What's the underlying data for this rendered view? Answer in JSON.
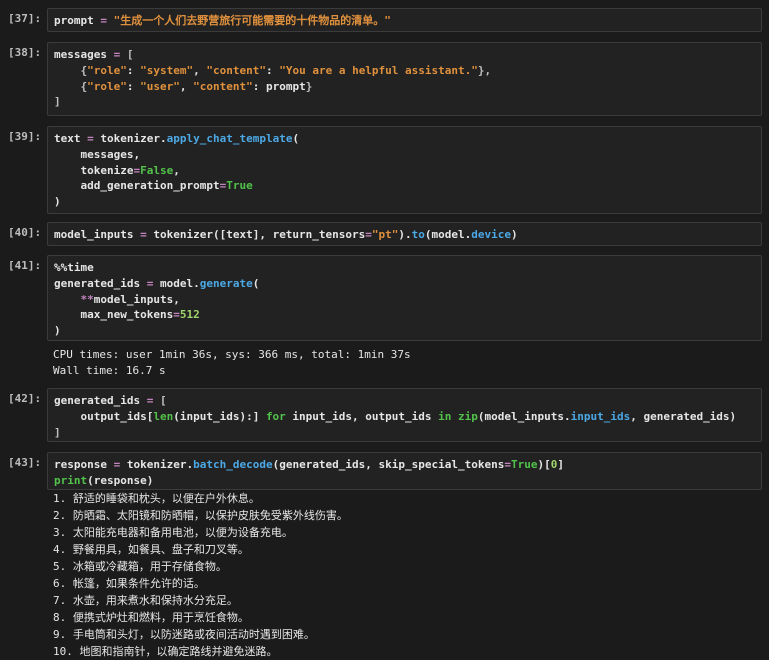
{
  "cells": [
    {
      "id": "cell-37",
      "label": "[37]:",
      "lines": [
        [
          [
            "var",
            "prompt"
          ],
          [
            "op",
            " = "
          ],
          [
            "str",
            "\"生成一个人们去野营旅行可能需要的十件物品的清单。\""
          ]
        ]
      ]
    },
    {
      "id": "cell-38",
      "label": "[38]:",
      "lines": [
        [
          [
            "var",
            "messages"
          ],
          [
            "op",
            " = "
          ],
          [
            "br",
            "["
          ]
        ],
        [
          [
            "var",
            "    "
          ],
          [
            "br",
            "{"
          ],
          [
            "str",
            "\"role\""
          ],
          [
            "var",
            ": "
          ],
          [
            "str",
            "\"system\""
          ],
          [
            "var",
            ", "
          ],
          [
            "str",
            "\"content\""
          ],
          [
            "var",
            ": "
          ],
          [
            "str",
            "\"You are a helpful assistant.\""
          ],
          [
            "br",
            "},"
          ]
        ],
        [
          [
            "var",
            "    "
          ],
          [
            "br",
            "{"
          ],
          [
            "str",
            "\"role\""
          ],
          [
            "var",
            ": "
          ],
          [
            "str",
            "\"user\""
          ],
          [
            "var",
            ", "
          ],
          [
            "str",
            "\"content\""
          ],
          [
            "var",
            ": prompt"
          ],
          [
            "br",
            "}"
          ]
        ],
        [
          [
            "br",
            "]"
          ]
        ]
      ]
    },
    {
      "id": "cell-39",
      "label": "[39]:",
      "lines": [
        [
          [
            "var",
            "text"
          ],
          [
            "op",
            " = "
          ],
          [
            "var",
            "tokenizer."
          ],
          [
            "fn",
            "apply_chat_template"
          ],
          [
            "var",
            "("
          ]
        ],
        [
          [
            "var",
            "    messages,"
          ]
        ],
        [
          [
            "var",
            "    tokenize"
          ],
          [
            "op",
            "="
          ],
          [
            "kw",
            "False"
          ],
          [
            "var",
            ","
          ]
        ],
        [
          [
            "var",
            "    add_generation_prompt"
          ],
          [
            "op",
            "="
          ],
          [
            "kw",
            "True"
          ]
        ],
        [
          [
            "var",
            ")"
          ]
        ]
      ]
    },
    {
      "id": "cell-40",
      "label": "[40]:",
      "lines": [
        [
          [
            "var",
            "model_inputs"
          ],
          [
            "op",
            " = "
          ],
          [
            "var",
            "tokenizer([text], return_tensors"
          ],
          [
            "op",
            "="
          ],
          [
            "str",
            "\"pt\""
          ],
          [
            "var",
            ")."
          ],
          [
            "fn",
            "to"
          ],
          [
            "var",
            "(model."
          ],
          [
            "fn",
            "device"
          ],
          [
            "var",
            ")"
          ]
        ]
      ]
    },
    {
      "id": "cell-41",
      "label": "[41]:",
      "lines": [
        [
          [
            "var",
            "%%time"
          ]
        ],
        [
          [
            "var",
            "generated_ids"
          ],
          [
            "op",
            " = "
          ],
          [
            "var",
            "model."
          ],
          [
            "fn",
            "generate"
          ],
          [
            "var",
            "("
          ]
        ],
        [
          [
            "var",
            "    "
          ],
          [
            "op",
            "**"
          ],
          [
            "var",
            "model_inputs,"
          ]
        ],
        [
          [
            "var",
            "    max_new_tokens"
          ],
          [
            "op",
            "="
          ],
          [
            "num",
            "512"
          ]
        ],
        [
          [
            "var",
            ")"
          ]
        ]
      ]
    },
    {
      "id": "cell-42",
      "label": "[42]:",
      "lines": [
        [
          [
            "var",
            "generated_ids"
          ],
          [
            "op",
            " = "
          ],
          [
            "br",
            "["
          ]
        ],
        [
          [
            "var",
            "    output_ids["
          ],
          [
            "kw",
            "len"
          ],
          [
            "var",
            "(input_ids):] "
          ],
          [
            "kw",
            "for"
          ],
          [
            "var",
            " input_ids, output_ids "
          ],
          [
            "kw",
            "in"
          ],
          [
            "var",
            " "
          ],
          [
            "kw",
            "zip"
          ],
          [
            "var",
            "(model_inputs."
          ],
          [
            "fn",
            "input_ids"
          ],
          [
            "var",
            ", generated_ids)"
          ]
        ],
        [
          [
            "br",
            "]"
          ]
        ]
      ]
    },
    {
      "id": "cell-43",
      "label": "[43]:",
      "lines": [
        [
          [
            "var",
            "response"
          ],
          [
            "op",
            " = "
          ],
          [
            "var",
            "tokenizer."
          ],
          [
            "fn",
            "batch_decode"
          ],
          [
            "var",
            "(generated_ids, skip_special_tokens"
          ],
          [
            "op",
            "="
          ],
          [
            "kw",
            "True"
          ],
          [
            "var",
            ")["
          ],
          [
            "num",
            "0"
          ],
          [
            "var",
            "]"
          ]
        ],
        [
          [
            "kw",
            "print"
          ],
          [
            "var",
            "(response)"
          ]
        ]
      ]
    }
  ],
  "outputs": {
    "cell-41": [
      "CPU times: user 1min 36s, sys: 366 ms, total: 1min 37s",
      "Wall time: 16.7 s"
    ],
    "cell-43": [
      "1. 舒适的睡袋和枕头，以便在户外休息。",
      "2. 防晒霜、太阳镜和防晒帽，以保护皮肤免受紫外线伤害。",
      "3. 太阳能充电器和备用电池，以便为设备充电。",
      "4. 野餐用具，如餐具、盘子和刀叉等。",
      "5. 冰箱或冷藏箱，用于存储食物。",
      "6. 帐篷，如果条件允许的话。",
      "7. 水壶，用来煮水和保持水分充足。",
      "8. 便携式炉灶和燃料，用于烹饪食物。",
      "9. 手电筒和头灯，以防迷路或夜间活动时遇到困难。",
      "10. 地图和指南针，以确定路线并避免迷路。"
    ]
  }
}
